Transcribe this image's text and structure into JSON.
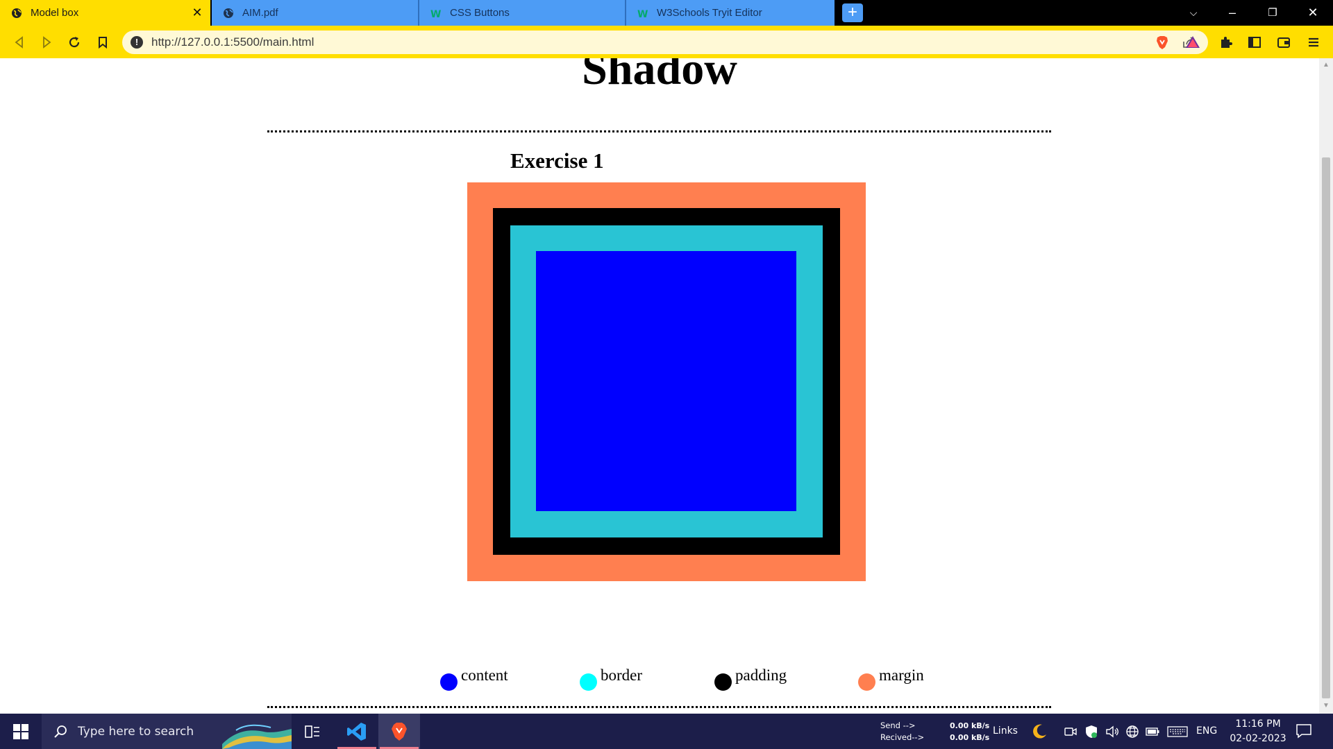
{
  "browser": {
    "tabs": [
      {
        "title": "Model box",
        "active": true
      },
      {
        "title": "AIM.pdf",
        "active": false
      },
      {
        "title": "CSS Buttons",
        "active": false
      },
      {
        "title": "W3Schools Tryit Editor",
        "active": false
      }
    ],
    "url": "http://127.0.0.1:5500/main.html",
    "accent_color": "#ffde00",
    "inactive_tab_color": "#4d9cf5"
  },
  "page": {
    "heading": "Shadow",
    "exercise_title": "Exercise 1",
    "box_colors": {
      "margin": "#ff7f50",
      "border": "#000000",
      "padding": "#29c4d4",
      "content": "#0000ff"
    },
    "legend": [
      {
        "label": "content",
        "color": "#0000ff"
      },
      {
        "label": "border",
        "color": "#00ffff"
      },
      {
        "label": "padding",
        "color": "#000000"
      },
      {
        "label": "margin",
        "color": "#ff7f50"
      }
    ]
  },
  "taskbar": {
    "search_placeholder": "Type here to search",
    "net_labels": [
      "Send -->",
      "Recived-->"
    ],
    "net_values": [
      "0.00 kB/s",
      "0.00 kB/s"
    ],
    "links_label": "Links",
    "language": "ENG",
    "time": "11:16 PM",
    "date": "02-02-2023"
  }
}
